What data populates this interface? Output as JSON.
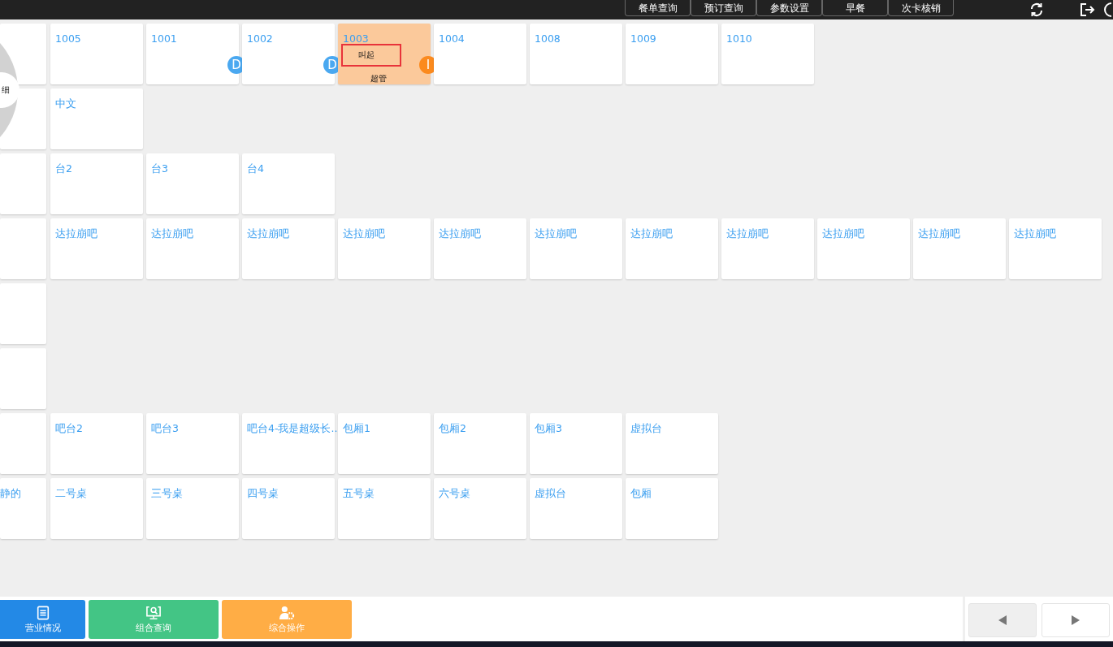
{
  "top_menu": [
    {
      "label": "餐单查询"
    },
    {
      "label": "预订查询"
    },
    {
      "label": "参数设置"
    },
    {
      "label": "早餐"
    },
    {
      "label": "次卡核销"
    }
  ],
  "popup": {
    "label": "细"
  },
  "table_rows": [
    {
      "cells": [
        {
          "selected": false
        },
        {
          "label": "1005",
          "selected": false
        },
        {
          "label": "1001",
          "selected": false,
          "badge": "D",
          "color": "#4aa8f0"
        },
        {
          "label": "1002",
          "selected": false,
          "badge": "D",
          "color": "#4aa8f0"
        },
        {
          "label": "1003",
          "selected": true,
          "note": "叫起",
          "user": "超管",
          "badge": "I",
          "color": "#fb8a1e"
        },
        {
          "label": "1004",
          "selected": false
        },
        {
          "label": "1008",
          "selected": false
        },
        {
          "label": "1009",
          "selected": false
        },
        {
          "label": "1010",
          "selected": false
        }
      ]
    },
    {
      "cells": [
        {
          "selected": false
        },
        {
          "label": "中文",
          "selected": false
        }
      ]
    },
    {
      "cells": [
        {
          "selected": false
        },
        {
          "label": "台2",
          "selected": false
        },
        {
          "label": "台3",
          "selected": false
        },
        {
          "label": "台4",
          "selected": false
        }
      ]
    },
    {
      "cells": [
        {
          "selected": false
        },
        {
          "label": "达拉崩吧",
          "selected": false
        },
        {
          "label": "达拉崩吧",
          "selected": false
        },
        {
          "label": "达拉崩吧",
          "selected": false
        },
        {
          "label": "达拉崩吧",
          "selected": false
        },
        {
          "label": "达拉崩吧",
          "selected": false
        },
        {
          "label": "达拉崩吧",
          "selected": false
        },
        {
          "label": "达拉崩吧",
          "selected": false
        },
        {
          "label": "达拉崩吧",
          "selected": false
        },
        {
          "label": "达拉崩吧",
          "selected": false
        },
        {
          "label": "达拉崩吧",
          "selected": false
        },
        {
          "label": "达拉崩吧",
          "selected": false
        }
      ]
    },
    {
      "cells": [
        {
          "selected": false
        }
      ]
    },
    {
      "cells": [
        {
          "selected": false
        }
      ]
    },
    {
      "cells": [
        {
          "selected": false
        },
        {
          "label": "吧台2",
          "selected": false
        },
        {
          "label": "吧台3",
          "selected": false
        },
        {
          "label": "吧台4-我是超级长..",
          "selected": false
        },
        {
          "label": "包厢1",
          "selected": false
        },
        {
          "label": "包厢2",
          "selected": false
        },
        {
          "label": "包厢3",
          "selected": false
        },
        {
          "label": "虚拟台",
          "selected": false
        }
      ]
    },
    {
      "cells": [
        {
          "label": "静的",
          "selected": false
        },
        {
          "label": "二号桌",
          "selected": false
        },
        {
          "label": "三号桌",
          "selected": false
        },
        {
          "label": "四号桌",
          "selected": false
        },
        {
          "label": "五号桌",
          "selected": false
        },
        {
          "label": "六号桌",
          "selected": false
        },
        {
          "label": "虚拟台",
          "selected": false
        },
        {
          "label": "包厢",
          "selected": false
        }
      ]
    }
  ],
  "bottom_buttons": [
    {
      "kind": "report",
      "label": "营业情况",
      "color": "#2389e6"
    },
    {
      "kind": "query",
      "label": "组合查询",
      "color": "#43c585"
    },
    {
      "kind": "operate",
      "label": "综合操作",
      "color": "#ffad45"
    }
  ],
  "pager": [
    {
      "kind": "prev",
      "disabled": true
    },
    {
      "kind": "next",
      "disabled": false
    }
  ]
}
